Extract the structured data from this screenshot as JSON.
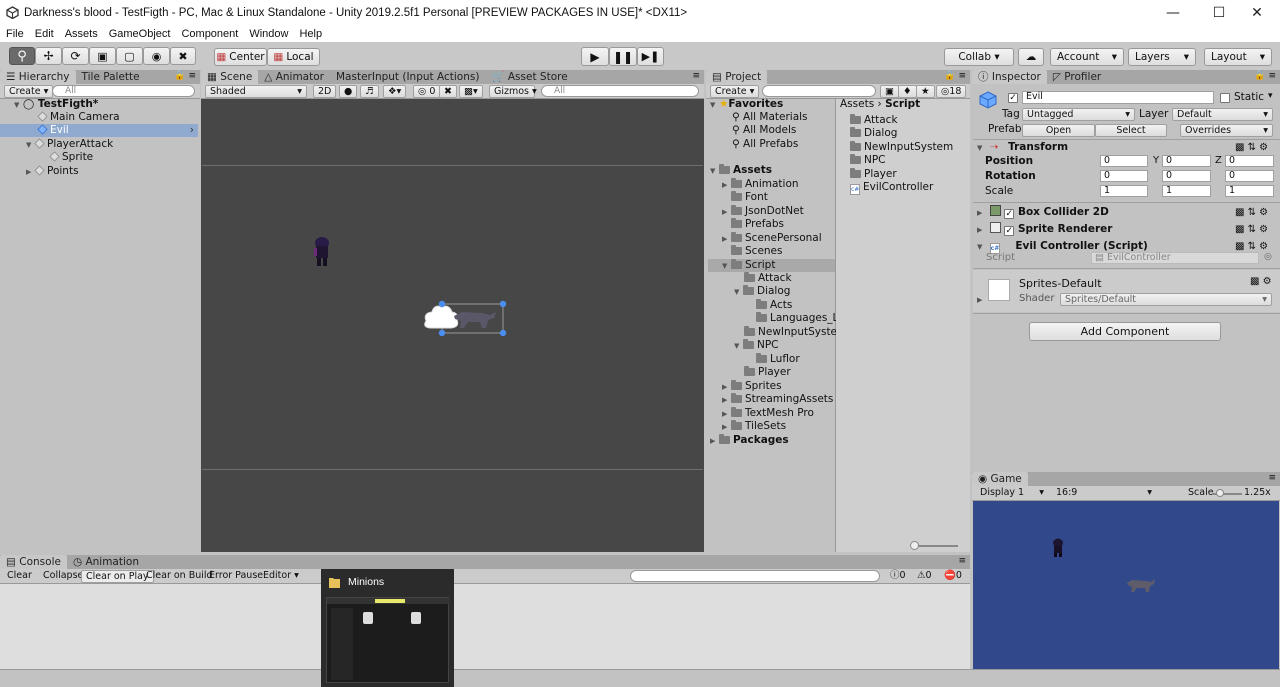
{
  "window": {
    "title": "Darkness's blood - TestFigth - PC, Mac & Linux Standalone - Unity 2019.2.5f1 Personal [PREVIEW PACKAGES IN USE]* <DX11>",
    "minimize": "—",
    "maximize": "☐",
    "close": "✕"
  },
  "menu": [
    "File",
    "Edit",
    "Assets",
    "GameObject",
    "Component",
    "Window",
    "Help"
  ],
  "toolbar": {
    "pivot_center": "Center",
    "pivot_local": "Local",
    "collab": "Collab ▾",
    "account": "Account",
    "layers": "Layers",
    "layout": "Layout"
  },
  "hierarchy": {
    "tabs": [
      "Hierarchy",
      "Tile Palette"
    ],
    "create": "Create ▾",
    "search_placeholder": "All",
    "items": [
      {
        "label": "TestFigth*"
      },
      {
        "label": "Main Camera"
      },
      {
        "label": "Evil"
      },
      {
        "label": "PlayerAttack"
      },
      {
        "label": "Sprite"
      },
      {
        "label": "Points"
      }
    ]
  },
  "scene": {
    "tabs": [
      "Scene",
      "Animator",
      "MasterInput (Input Actions)",
      "Asset Store"
    ],
    "shading": "Shaded",
    "mode_2d": "2D",
    "fx_count": "0",
    "gizmos": "Gizmos",
    "search_placeholder": "All"
  },
  "project": {
    "tabs": [
      "Project"
    ],
    "create": "Create ▾",
    "hidden_count": "18",
    "favorites_label": "Favorites",
    "favorites": [
      "All Materials",
      "All Models",
      "All Prefabs"
    ],
    "assets_label": "Assets",
    "tree": [
      "Animation",
      "Font",
      "JsonDotNet",
      "Prefabs",
      "ScenePersonal",
      "Scenes",
      "Script",
      "Attack",
      "Dialog",
      "Acts",
      "Languages_Lo",
      "NewInputSysten",
      "NPC",
      "Luflor",
      "Player",
      "Sprites",
      "StreamingAssets",
      "TextMesh Pro",
      "TileSets"
    ],
    "packages_label": "Packages",
    "breadcrumb_root": "Assets",
    "breadcrumb_current": "Script",
    "folder_contents": [
      "Attack",
      "Dialog",
      "NewInputSystem",
      "NPC",
      "Player",
      "EvilController"
    ]
  },
  "inspector": {
    "tabs": [
      "Inspector",
      "Profiler"
    ],
    "object_name": "Evil",
    "static_label": "Static",
    "tag_label": "Tag",
    "tag_value": "Untagged",
    "layer_label": "Layer",
    "layer_value": "Default",
    "prefab_label": "Prefab",
    "prefab_open": "Open",
    "prefab_select": "Select",
    "prefab_overrides": "Overrides",
    "transform": {
      "title": "Transform",
      "position_label": "Position",
      "rotation_label": "Rotation",
      "scale_label": "Scale",
      "axis_x": "X",
      "axis_y": "Y",
      "axis_z": "Z",
      "position": [
        "0",
        "0",
        "0"
      ],
      "rotation": [
        "0",
        "0",
        "0"
      ],
      "scale": [
        "1",
        "1",
        "1"
      ]
    },
    "box_collider": "Box Collider 2D",
    "sprite_renderer": "Sprite Renderer",
    "evil_controller": "Evil Controller (Script)",
    "script_label": "Script",
    "script_value": "EvilController",
    "material_name": "Sprites-Default",
    "shader_label": "Shader",
    "shader_value": "Sprites/Default",
    "add_component": "Add Component"
  },
  "game": {
    "tab": "Game",
    "display": "Display 1",
    "aspect": "16:9",
    "scale_label": "Scale",
    "scale_value": "1.25x"
  },
  "console": {
    "tabs": [
      "Console",
      "Animation"
    ],
    "buttons": [
      "Clear",
      "Collapse",
      "Clear on Play",
      "Clear on Build",
      "Error Pause",
      "Editor ▾"
    ],
    "log_count": "0",
    "warn_count": "0",
    "error_count": "0"
  },
  "taskbar_preview": {
    "title": "Minions"
  },
  "colors": {
    "selection": "#8fa9cf",
    "scene_bg": "#474747",
    "game_bg": "#31498a"
  }
}
